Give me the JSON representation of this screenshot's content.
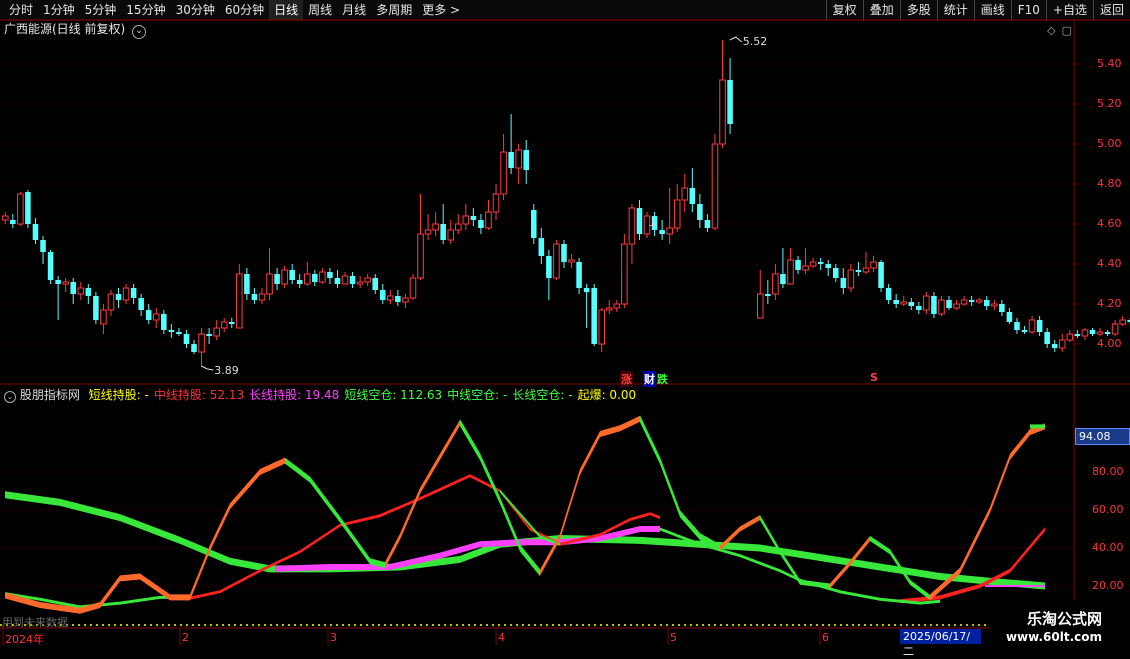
{
  "toolbar": {
    "periods": [
      "分时",
      "1分钟",
      "5分钟",
      "15分钟",
      "30分钟",
      "60分钟",
      "日线",
      "周线",
      "月线",
      "多周期",
      "更多 >"
    ],
    "active": "日线",
    "actions": [
      "复权",
      "叠加",
      "多股",
      "统计",
      "画线",
      "F10",
      "+自选",
      "返回"
    ]
  },
  "main_chart": {
    "title": "广西能源(日线 前复权)",
    "title_arrow": "⌄",
    "high_label": "5.52",
    "low_label": "3.89",
    "y_ticks": [
      "5.40",
      "5.20",
      "5.00",
      "4.80",
      "4.60",
      "4.40",
      "4.20",
      "4.00"
    ],
    "event_up": "涨",
    "event_fin": "财",
    "event_down": "跌",
    "event_s": "S"
  },
  "indicator": {
    "name": "股朋指标网",
    "fields": [
      {
        "label": "短线持股:",
        "value": "-",
        "color": "#ffff00"
      },
      {
        "label": "中线持股:",
        "value": "52.13",
        "color": "#ff3030"
      },
      {
        "label": "长线持股:",
        "value": "19.48",
        "color": "#ff40ff"
      },
      {
        "label": "短线空仓:",
        "value": "112.63",
        "color": "#40ff40"
      },
      {
        "label": "中线空仓:",
        "value": "-",
        "color": "#40ff40"
      },
      {
        "label": "长线空仓:",
        "value": "-",
        "color": "#40ff40"
      },
      {
        "label": "起爆:",
        "value": "0.00",
        "color": "#ffff00"
      }
    ],
    "y_ticks": [
      "80.00",
      "60.00",
      "40.00",
      "20.00"
    ],
    "current_tag": "94.08"
  },
  "x_axis": {
    "labels": [
      "2024年",
      "2",
      "3",
      "4",
      "5",
      "6"
    ],
    "cursor_date": "2025/06/17/二"
  },
  "footer": {
    "left_text": "用到未来数据",
    "watermark_1": "乐淘公式网",
    "watermark_2": "www.60lt.com"
  },
  "colors": {
    "up": "#ff3c3c",
    "down": "#54ffff",
    "axis": "#800000",
    "orange": "#ff6a2a",
    "green": "#37e83a",
    "magenta": "#ff40ff",
    "red": "#ff2020"
  }
}
